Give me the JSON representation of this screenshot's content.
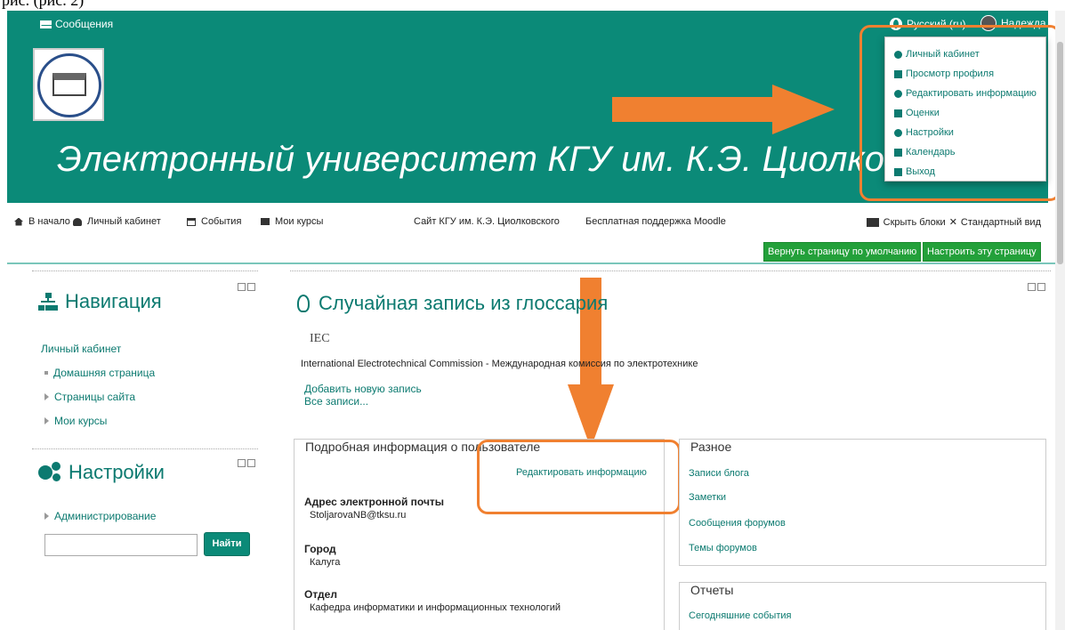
{
  "caption_fragment": "рис. (рис. 2)",
  "topbar": {
    "messages": "Сообщения",
    "language": "Русский (ru)",
    "user": "Надежда"
  },
  "header": {
    "site_title": "Электронный университет КГУ им. К.Э. Циолковского"
  },
  "user_menu": {
    "items": [
      {
        "label": "Личный кабинет",
        "icon": "dashboard-icon"
      },
      {
        "label": "Просмотр профиля",
        "icon": "user-icon"
      },
      {
        "label": "Редактировать информацию",
        "icon": "cog-icon"
      },
      {
        "label": "Оценки",
        "icon": "table-icon"
      },
      {
        "label": "Настройки",
        "icon": "cog-icon"
      },
      {
        "label": "Календарь",
        "icon": "calendar-icon"
      },
      {
        "label": "Выход",
        "icon": "signout-icon"
      }
    ]
  },
  "navbar": {
    "home": "В начало",
    "dashboard": "Личный кабинет",
    "events": "События",
    "my_courses": "Мои курсы",
    "university_site": "Сайт КГУ им. К.Э. Циолковского",
    "moodle_support": "Бесплатная поддержка Moodle",
    "hide_blocks": "Скрыть блоки",
    "standard_view": "Стандартный вид"
  },
  "page_buttons": {
    "reset": "Вернуть страницу по умолчанию",
    "customize": "Настроить эту страницу"
  },
  "navigation_block": {
    "title": "Навигация",
    "root": "Личный кабинет",
    "items": [
      "Домашняя страница",
      "Страницы сайта",
      "Мои курсы"
    ]
  },
  "settings_block": {
    "title": "Настройки",
    "items": [
      "Администрирование"
    ],
    "search_button": "Найти",
    "search_value": ""
  },
  "glossary_block": {
    "title": "Случайная запись из глоссария",
    "term": "IEC",
    "definition": "International Electrotechnical Commission - Международная комиссия по электротехнике",
    "add_entry": "Добавить новую запись",
    "all_entries": "Все записи..."
  },
  "user_details": {
    "title": "Подробная информация о пользователе",
    "edit_link": "Редактировать информацию",
    "email_label": "Адрес электронной почты",
    "email_value": "StoljarovaNB@tksu.ru",
    "city_label": "Город",
    "city_value": "Калуга",
    "department_label": "Отдел",
    "department_value": "Кафедра информатики и информационных технологий"
  },
  "misc_block": {
    "title": "Разное",
    "links": [
      "Записи блога",
      "Заметки",
      "Сообщения форумов",
      "Темы форумов"
    ]
  },
  "reports_block": {
    "title": "Отчеты",
    "links": [
      "Сегодняшние события"
    ]
  },
  "colors": {
    "brand": "#0b8a78",
    "annotation": "#f08030",
    "button_green": "#23a03a"
  }
}
